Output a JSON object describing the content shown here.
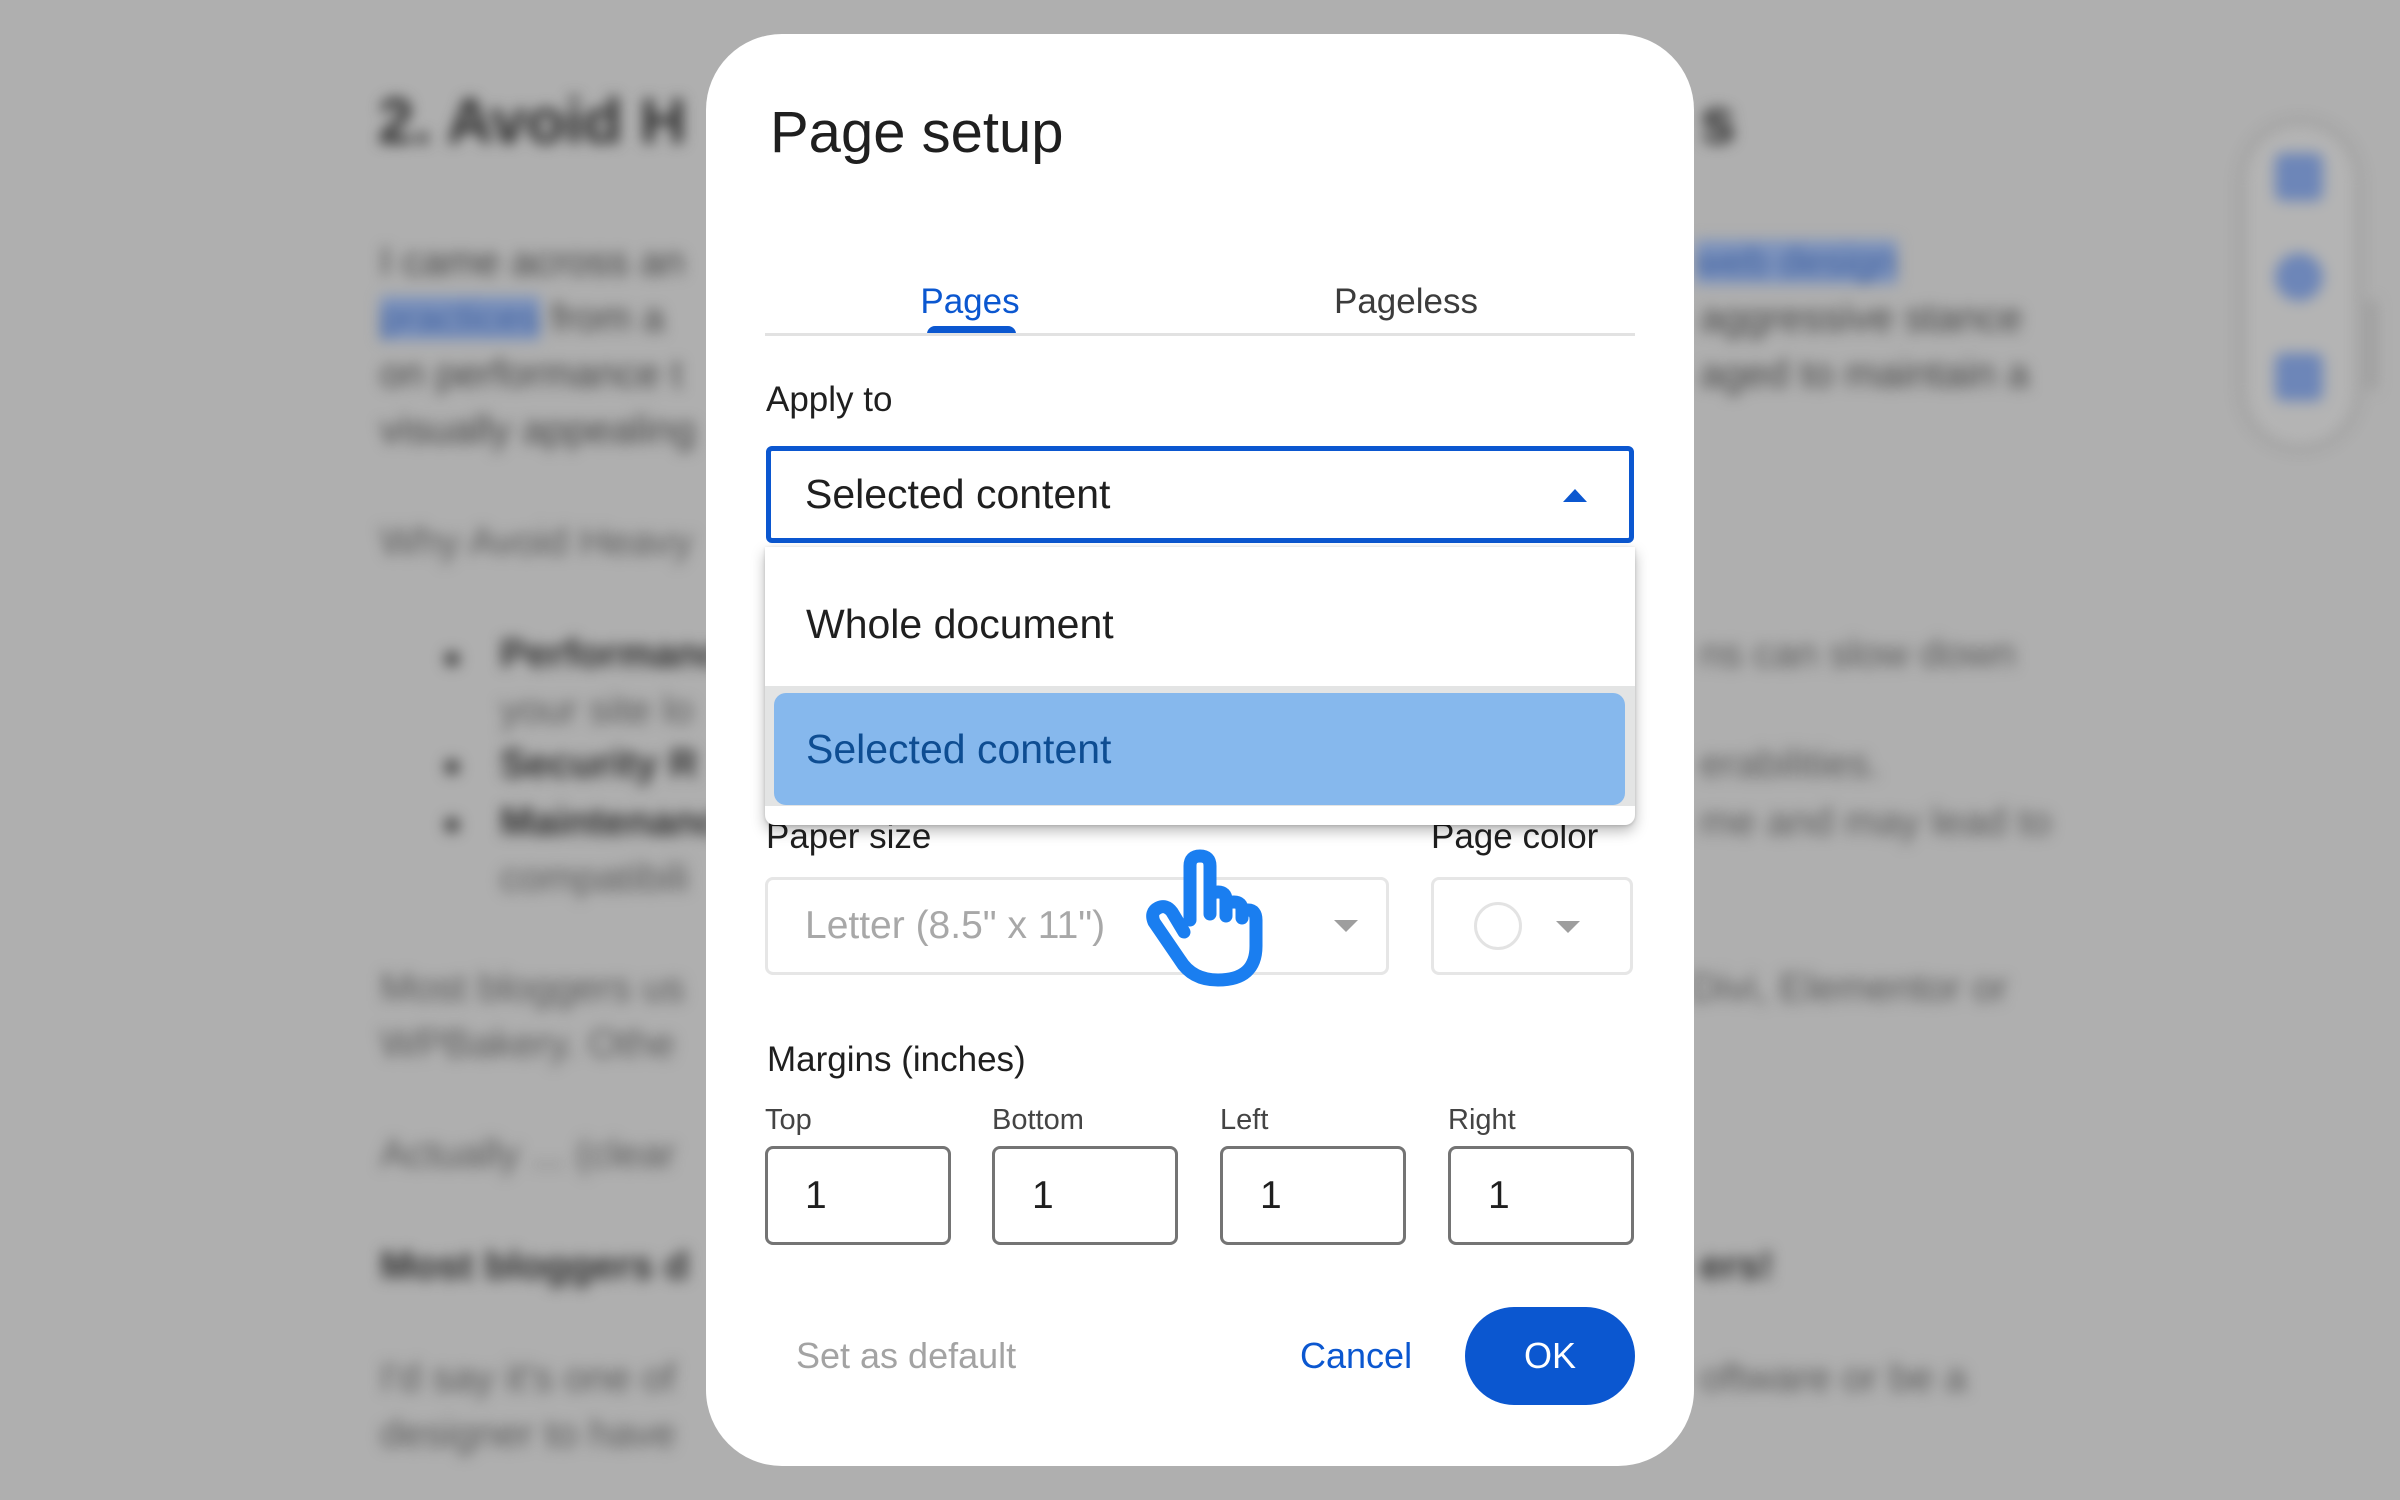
{
  "background_document": {
    "heading": "2. Avoid H",
    "heading_tail": "s",
    "paragraph1": [
      {
        "left": "I came across an",
        "right": "web design"
      },
      {
        "left_link": "practices",
        "left": " from a",
        "right": "aggressive stance"
      },
      {
        "left": "on performance t",
        "right": "aged to maintain a"
      },
      {
        "left": "visually appealing",
        "right": ""
      }
    ],
    "why_line": "Why Avoid Heavy",
    "bullets": [
      {
        "title": "Performance",
        "right": "ns can slow down",
        "continuation": "your site lo"
      },
      {
        "title": "Security R",
        "right": "erabilities.",
        "continuation": ""
      },
      {
        "title": "Maintenanc",
        "right": "me and may lead to",
        "continuation": "compatibili"
      }
    ],
    "paragraph2": [
      {
        "left": "Most bloggers us",
        "right": "Divi, Elementor or"
      },
      {
        "left": "WPBakery. Othe",
        "right": ""
      }
    ],
    "actually_line": "Actually ... (clear",
    "bold_line": {
      "left": "Most bloggers d",
      "right": "ers!"
    },
    "paragraph3": [
      {
        "left": "I'd say it's one of",
        "right": "oftware or be a"
      },
      {
        "left": "designer to have",
        "right": ""
      }
    ]
  },
  "dialog": {
    "title": "Page setup",
    "tabs": [
      {
        "label": "Pages",
        "active": true
      },
      {
        "label": "Pageless",
        "active": false
      }
    ],
    "apply_to": {
      "label": "Apply to",
      "selected": "Selected content",
      "expanded": true,
      "options": [
        {
          "label": "Whole document",
          "highlighted": false
        },
        {
          "label": "Selected content",
          "highlighted": true
        }
      ]
    },
    "paper_size": {
      "label": "Paper size",
      "value": "Letter (8.5\" x 11\")",
      "disabled": true
    },
    "page_color": {
      "label": "Page color",
      "value": "white",
      "disabled": true
    },
    "margins": {
      "label": "Margins (inches)",
      "fields": [
        {
          "label": "Top",
          "value": "1"
        },
        {
          "label": "Bottom",
          "value": "1"
        },
        {
          "label": "Left",
          "value": "1"
        },
        {
          "label": "Right",
          "value": "1"
        }
      ]
    },
    "footer": {
      "set_default": "Set as default",
      "cancel": "Cancel",
      "ok": "OK"
    }
  },
  "colors": {
    "accent": "#0b57d0",
    "highlight": "#86b8ed",
    "cursor": "#1a7ef0",
    "overlay": "#afafaf"
  },
  "cursor": {
    "icon": "pointing-hand-cursor"
  }
}
